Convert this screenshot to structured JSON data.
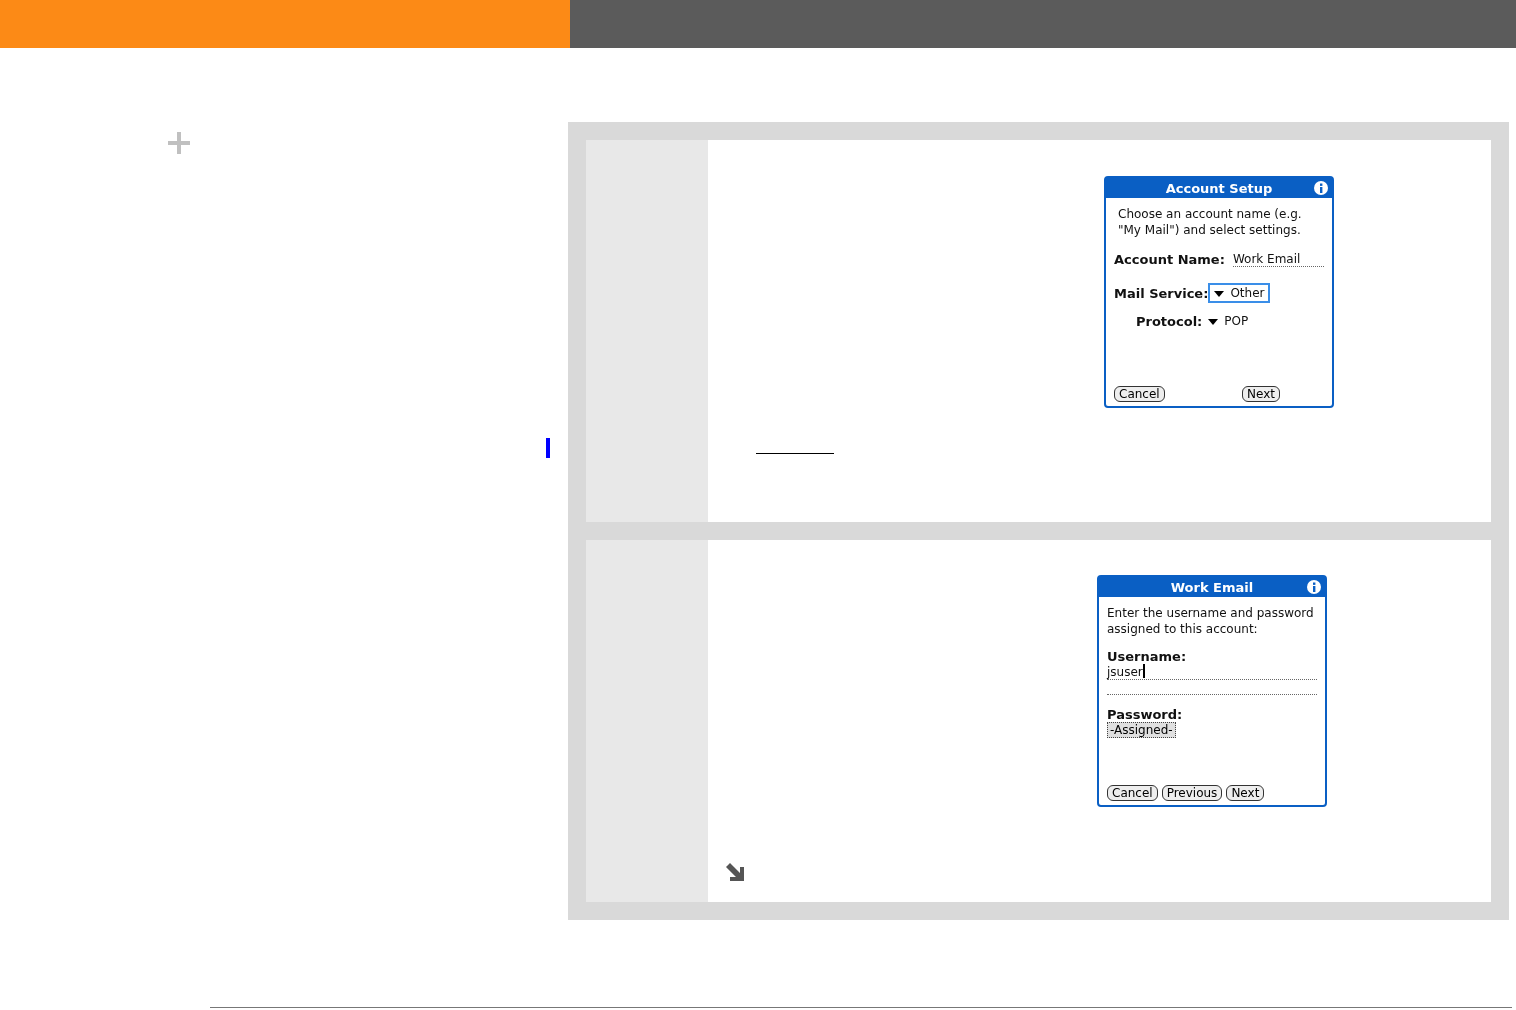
{
  "steps": [
    {
      "dialog": {
        "title": "Account Setup",
        "message": "Choose an account name (e.g. \"My Mail\") and select settings.",
        "fields": [
          {
            "kind": "text",
            "label": "Account Name:",
            "value": "Work Email"
          },
          {
            "kind": "dropdown",
            "label": "Mail Service:",
            "value": "Other",
            "focused": true
          },
          {
            "kind": "dropdown",
            "label": "Protocol:",
            "value": "POP",
            "focused": false
          }
        ],
        "buttons": [
          "Cancel",
          "Next"
        ]
      },
      "link": true
    },
    {
      "dialog": {
        "title": "Work Email",
        "message": "Enter the username and password assigned to this account:",
        "fields": [
          {
            "kind": "stacked-text",
            "label": "Username:",
            "value": "jsuser",
            "focused": true
          },
          {
            "kind": "stacked-button",
            "label": "Password:",
            "value": "-Assigned-"
          }
        ],
        "buttons": [
          "Cancel",
          "Previous",
          "Next"
        ]
      },
      "arrow": true
    }
  ]
}
